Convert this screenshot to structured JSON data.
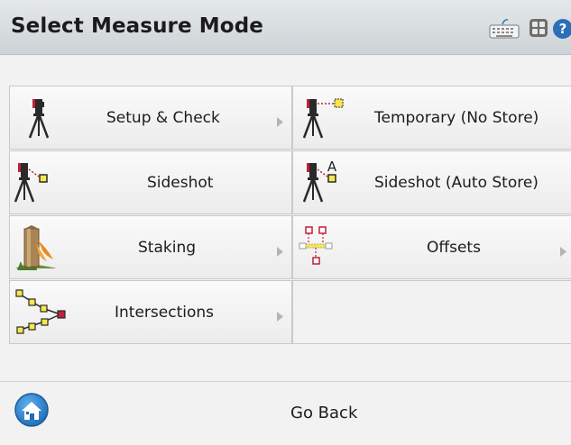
{
  "header": {
    "title": "Select Measure Mode",
    "icons": [
      "keyboard-icon",
      "grid-icon",
      "help-icon"
    ]
  },
  "menu": {
    "items": [
      {
        "label": "Setup & Check",
        "icon": "tripod-icon",
        "has_submenu": true
      },
      {
        "label": "Temporary (No Store)",
        "icon": "tripod-temporary-icon",
        "has_submenu": false
      },
      {
        "label": "Sideshot",
        "icon": "tripod-sideshot-icon",
        "has_submenu": false
      },
      {
        "label": "Sideshot (Auto Store)",
        "icon": "tripod-autostore-icon",
        "has_submenu": false
      },
      {
        "label": "Staking",
        "icon": "stake-icon",
        "has_submenu": true
      },
      {
        "label": "Offsets",
        "icon": "offsets-icon",
        "has_submenu": true
      },
      {
        "label": "Intersections",
        "icon": "intersections-icon",
        "has_submenu": true
      }
    ]
  },
  "footer": {
    "go_back_label": "Go Back",
    "home_icon": "home-icon"
  },
  "colors": {
    "header_bg": "#d5dadd",
    "accent_blue": "#1e6bb5",
    "marker_yellow": "#f6e84a",
    "marker_red": "#c0203a"
  }
}
